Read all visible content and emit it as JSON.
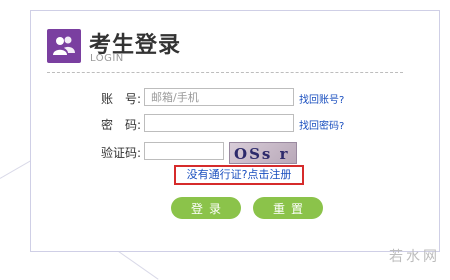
{
  "header": {
    "title": "考生登录",
    "subtitle": "LOGIN"
  },
  "form": {
    "account_label": "账　号:",
    "account_placeholder": "邮箱/手机",
    "account_value": "",
    "find_account_link": "找回账号?",
    "password_label": "密　码:",
    "password_value": "",
    "find_password_link": "找回密码?",
    "captcha_label": "验证码:",
    "captcha_value": "",
    "captcha_text": "OSs r",
    "register_link": "没有通行证?点击注册"
  },
  "buttons": {
    "login_label": "登录",
    "reset_label": "重置"
  },
  "watermark": "若水网",
  "colors": {
    "brand_purple": "#7a3fa0",
    "button_green": "#8bc34a",
    "link_blue": "#1a4fbf",
    "highlight_red": "#d62b2b"
  }
}
